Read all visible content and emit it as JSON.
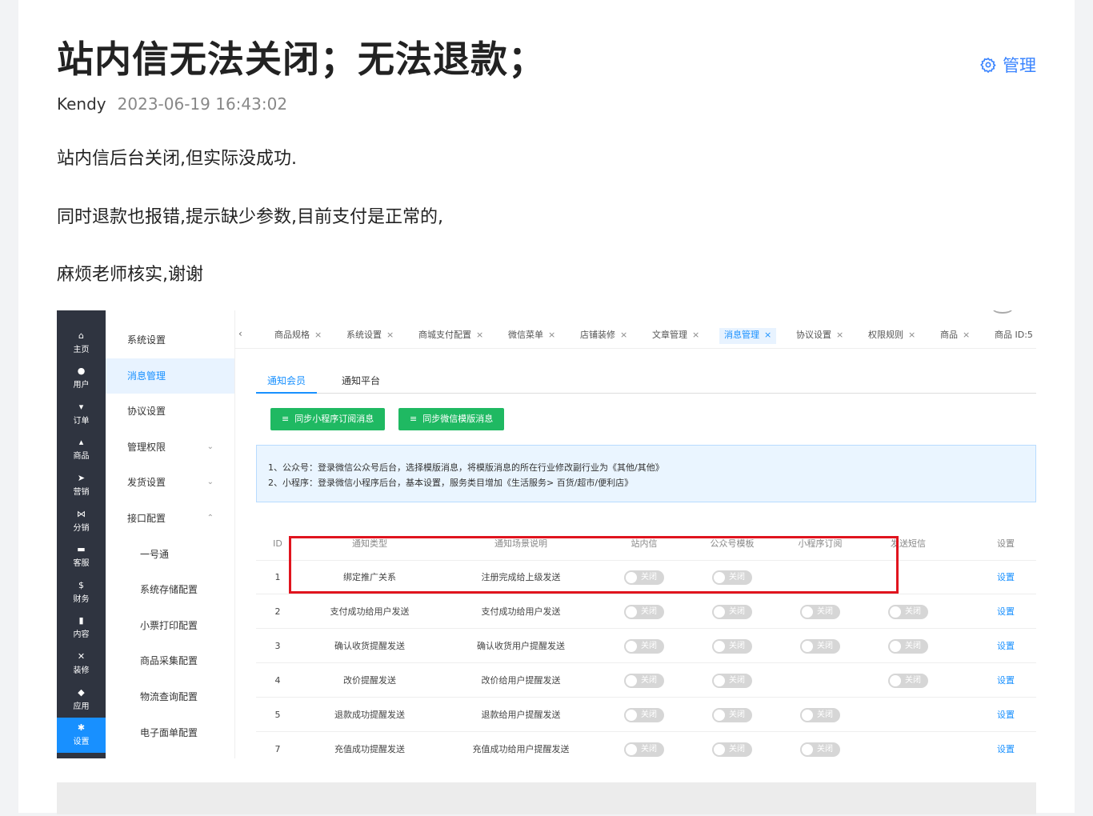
{
  "post": {
    "title": "站内信无法关闭；无法退款；",
    "manage_label": "管理",
    "author": "Kendy",
    "date": "2023-06-19 16:43:02",
    "paragraphs": [
      "站内信后台关闭,但实际没成功.",
      "同时退款也报错,提示缺少参数,目前支付是正常的,",
      "麻烦老师核实,谢谢"
    ]
  },
  "screenshot": {
    "left_nav": [
      {
        "icon": "home-icon",
        "glyph": "⌂",
        "label": "主页"
      },
      {
        "icon": "user-icon",
        "glyph": "●",
        "label": "用户"
      },
      {
        "icon": "cart-icon",
        "glyph": "▾",
        "label": "订单"
      },
      {
        "icon": "bag-icon",
        "glyph": "▴",
        "label": "商品"
      },
      {
        "icon": "send-icon",
        "glyph": "➤",
        "label": "营销"
      },
      {
        "icon": "share-icon",
        "glyph": "⋈",
        "label": "分销"
      },
      {
        "icon": "chat-icon",
        "glyph": "▬",
        "label": "客服"
      },
      {
        "icon": "dollar-icon",
        "glyph": "$",
        "label": "财务"
      },
      {
        "icon": "book-icon",
        "glyph": "▮",
        "label": "内容"
      },
      {
        "icon": "tools-icon",
        "glyph": "✕",
        "label": "装修"
      },
      {
        "icon": "cube-icon",
        "glyph": "◆",
        "label": "应用"
      },
      {
        "icon": "gear-icon",
        "glyph": "✱",
        "label": "设置"
      }
    ],
    "sub_nav": [
      {
        "label": "系统设置",
        "chevron": ""
      },
      {
        "label": "消息管理",
        "chevron": ""
      },
      {
        "label": "协议设置",
        "chevron": ""
      },
      {
        "label": "管理权限",
        "chevron": "⌄"
      },
      {
        "label": "发货设置",
        "chevron": "⌄"
      },
      {
        "label": "接口配置",
        "chevron": "⌃"
      },
      {
        "label": "一号通",
        "chevron": ""
      },
      {
        "label": "系统存储配置",
        "chevron": ""
      },
      {
        "label": "小票打印配置",
        "chevron": ""
      },
      {
        "label": "商品采集配置",
        "chevron": ""
      },
      {
        "label": "物流查询配置",
        "chevron": ""
      },
      {
        "label": "电子面单配置",
        "chevron": ""
      }
    ],
    "back_glyph": "‹",
    "tabs": [
      "商品规格",
      "系统设置",
      "商城支付配置",
      "微信菜单",
      "店铺装修",
      "文章管理",
      "消息管理",
      "协议设置",
      "权限规则",
      "商品",
      "商品 ID:5"
    ],
    "close_glyph": "×",
    "inner_tabs": [
      "通知会员",
      "通知平台"
    ],
    "buttons": [
      "同步小程序订阅消息",
      "同步微信模版消息"
    ],
    "button_glyph": "≡",
    "notice_lines": [
      "1、公众号：登录微信公众号后台，选择模版消息，将模版消息的所在行业修改副行业为《其他/其他》",
      "2、小程序：登录微信小程序后台，基本设置，服务类目增加《生活服务> 百货/超市/便利店》"
    ],
    "table_headers": [
      "ID",
      "通知类型",
      "通知场景说明",
      "站内信",
      "公众号模板",
      "小程序订阅",
      "发送短信",
      "设置"
    ],
    "switch_label": "关闭",
    "rows": [
      {
        "id": "1",
        "type": "绑定推广关系",
        "scene": "注册完成给上级发送",
        "action": "设置"
      },
      {
        "id": "2",
        "type": "支付成功给用户发送",
        "scene": "支付成功给用户发送",
        "action": "设置"
      },
      {
        "id": "3",
        "type": "确认收货提醒发送",
        "scene": "确认收货用户提醒发送",
        "action": "设置"
      },
      {
        "id": "4",
        "type": "改价提醒发送",
        "scene": "改价给用户提醒发送",
        "action": "设置"
      },
      {
        "id": "5",
        "type": "退款成功提醒发送",
        "scene": "退款给用户提醒发送",
        "action": "设置"
      },
      {
        "id": "7",
        "type": "充值成功提醒发送",
        "scene": "充值成功给用户提醒发送",
        "action": "设置"
      }
    ]
  }
}
